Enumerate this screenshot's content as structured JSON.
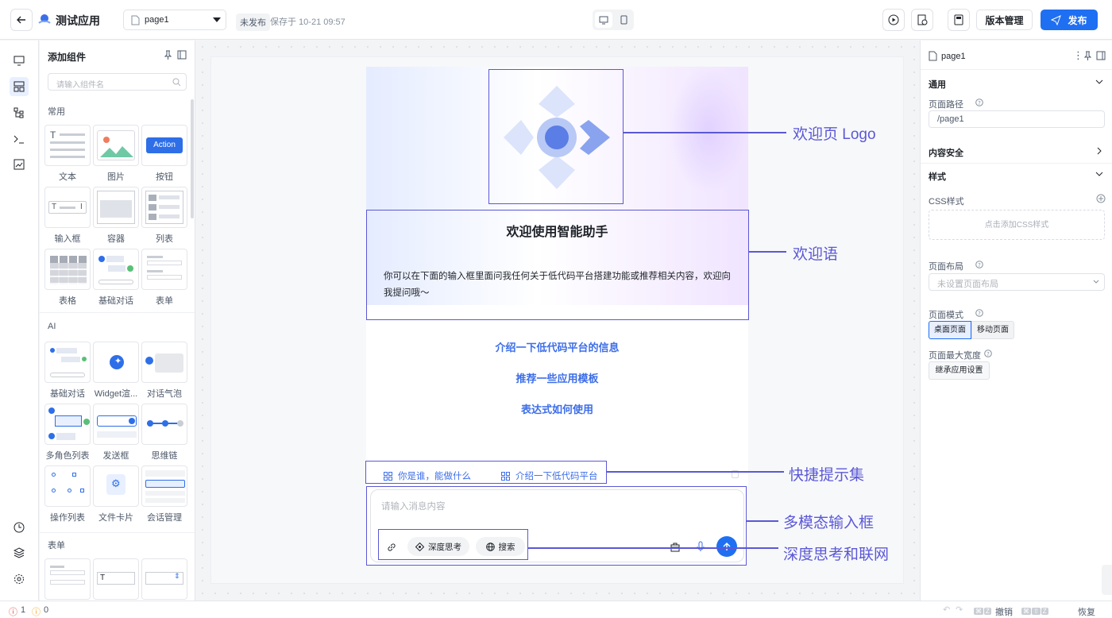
{
  "app": {
    "title": "测试应用"
  },
  "header": {
    "page_select": "page1",
    "status_badge": "未发布",
    "saved_text": "保存于 10-21 09:57",
    "version_button": "版本管理",
    "publish_button": "发布"
  },
  "component_panel": {
    "title": "添加组件",
    "search_placeholder": "请输入组件名",
    "sections": {
      "common": "常用",
      "ai": "AI",
      "form": "表单"
    },
    "common_items": [
      "文本",
      "图片",
      "按钮",
      "输入框",
      "容器",
      "列表",
      "表格",
      "基础对话",
      "表单"
    ],
    "ai_items": [
      "基础对话",
      "Widget渲...",
      "对话气泡",
      "多角色列表",
      "发送框",
      "思维链",
      "操作列表",
      "文件卡片",
      "会话管理"
    ],
    "action_thumb_label": "Action"
  },
  "canvas": {
    "welcome_title": "欢迎使用智能助手",
    "welcome_body_line1": "你可以在下面的输入框里面问我任何关于低代码平台搭建功能或推荐相关内容，欢迎向",
    "welcome_body_line2": "我提问哦～",
    "suggestions": [
      "介绍一下低代码平台的信息",
      "推荐一些应用模板",
      "表达式如何使用"
    ],
    "quick_prompts": [
      "你是谁，能做什么",
      "介绍一下低代码平台"
    ],
    "input_placeholder": "请输入消息内容",
    "deep_think": "深度思考",
    "search": "搜索"
  },
  "annotations": {
    "logo": "欢迎页 Logo",
    "welcome": "欢迎语",
    "prompts": "快捷提示集",
    "input": "多模态输入框",
    "deep": "深度思考和联网"
  },
  "props_panel": {
    "page_name": "page1",
    "general": "通用",
    "page_path_label": "页面路径",
    "page_path_value": "/page1",
    "content_security": "内容安全",
    "style": "样式",
    "css_label": "CSS样式",
    "css_add": "点击添加CSS样式",
    "layout_label": "页面布局",
    "layout_placeholder": "未设置页面布局",
    "mode_label": "页面模式",
    "mode_desktop": "桌面页面",
    "mode_mobile": "移动页面",
    "max_width_label": "页面最大宽度",
    "max_width_value": "继承应用设置"
  },
  "statusbar": {
    "errors": "1",
    "warnings": "0",
    "undo": "撤销",
    "redo": "恢复"
  },
  "colors": {
    "accent": "#1f6ff2",
    "annotation": "#5b58d6",
    "link": "#3d6ee8"
  }
}
